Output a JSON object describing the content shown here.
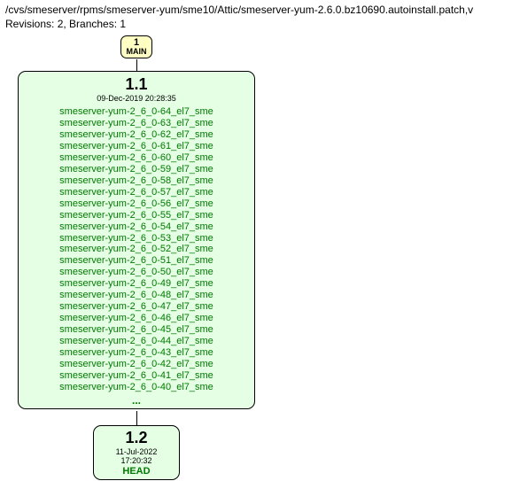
{
  "header": {
    "path": "/cvs/smeserver/rpms/smeserver-yum/sme10/Attic/smeserver-yum-2.6.0.bz10690.autoinstall.patch,v",
    "revisions_line": "Revisions: 2, Branches: 1"
  },
  "main_node": {
    "number": "1",
    "label": "MAIN"
  },
  "rev_1_1": {
    "title": "1.1",
    "date": "09-Dec-2019 20:28:35",
    "tags": [
      "smeserver-yum-2_6_0-64_el7_sme",
      "smeserver-yum-2_6_0-63_el7_sme",
      "smeserver-yum-2_6_0-62_el7_sme",
      "smeserver-yum-2_6_0-61_el7_sme",
      "smeserver-yum-2_6_0-60_el7_sme",
      "smeserver-yum-2_6_0-59_el7_sme",
      "smeserver-yum-2_6_0-58_el7_sme",
      "smeserver-yum-2_6_0-57_el7_sme",
      "smeserver-yum-2_6_0-56_el7_sme",
      "smeserver-yum-2_6_0-55_el7_sme",
      "smeserver-yum-2_6_0-54_el7_sme",
      "smeserver-yum-2_6_0-53_el7_sme",
      "smeserver-yum-2_6_0-52_el7_sme",
      "smeserver-yum-2_6_0-51_el7_sme",
      "smeserver-yum-2_6_0-50_el7_sme",
      "smeserver-yum-2_6_0-49_el7_sme",
      "smeserver-yum-2_6_0-48_el7_sme",
      "smeserver-yum-2_6_0-47_el7_sme",
      "smeserver-yum-2_6_0-46_el7_sme",
      "smeserver-yum-2_6_0-45_el7_sme",
      "smeserver-yum-2_6_0-44_el7_sme",
      "smeserver-yum-2_6_0-43_el7_sme",
      "smeserver-yum-2_6_0-42_el7_sme",
      "smeserver-yum-2_6_0-41_el7_sme",
      "smeserver-yum-2_6_0-40_el7_sme"
    ],
    "ellipsis": "..."
  },
  "rev_1_2": {
    "title": "1.2",
    "date": "11-Jul-2022 17:20:32",
    "tag": "HEAD"
  }
}
